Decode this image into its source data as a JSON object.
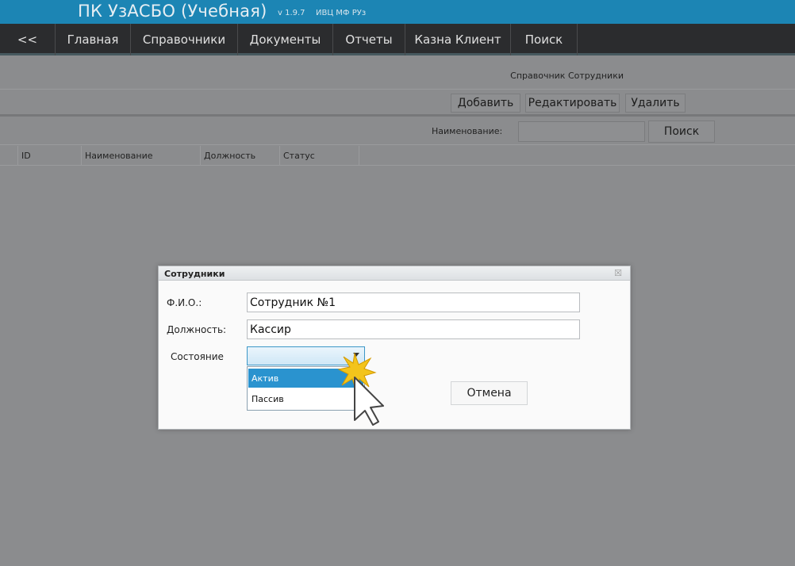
{
  "app": {
    "title": "ПК УзАСБО (Учебная)",
    "version": "v 1.9.7",
    "org": "ИВЦ МФ РУз"
  },
  "nav": {
    "back": "<<",
    "items": [
      "Главная",
      "Справочники",
      "Документы",
      "Отчеты",
      "Казна Клиент",
      "Поиск"
    ]
  },
  "page": {
    "title": "Справочник Сотрудники",
    "toolbar": {
      "add": "Добавить",
      "edit": "Редактировать",
      "delete": "Удалить"
    },
    "search": {
      "label": "Наименование:",
      "value": "",
      "button": "Поиск"
    },
    "table": {
      "columns": [
        "ID",
        "Наименование",
        "Должность",
        "Статус"
      ]
    }
  },
  "dialog": {
    "title": "Сотрудники",
    "close": "☒",
    "fio_label": "Ф.И.О.:",
    "fio_value": "Сотрудник №1",
    "position_label": "Должность:",
    "position_value": "Кассир",
    "status_label": "Состояние",
    "status_value": "",
    "options": [
      "Актив",
      "Пассив"
    ],
    "cancel": "Отмена"
  },
  "colors": {
    "titlebar": "#1c85b4",
    "navbar": "#2b2c2e",
    "overlay": "#8b8c8e",
    "selected_option": "#2a93cf"
  }
}
